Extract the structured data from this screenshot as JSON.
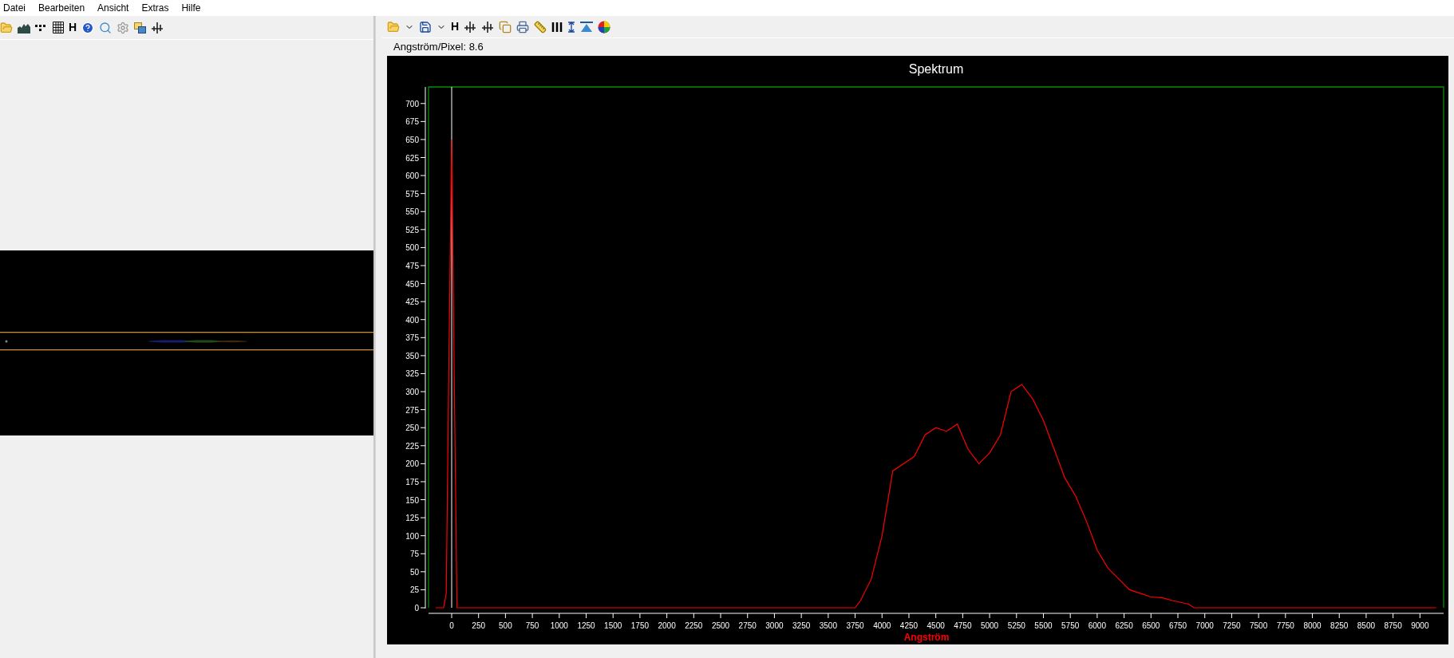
{
  "menu": [
    "Datei",
    "Bearbeiten",
    "Ansicht",
    "Extras",
    "Hilfe"
  ],
  "left_toolbar": {
    "h_label": "H"
  },
  "right_toolbar": {
    "h_label": "H"
  },
  "scale_label": "Angström/Pixel: 8.6",
  "spectrum_chart": {
    "chart_data": {
      "type": "line",
      "title": "Spektrum",
      "xlabel": "Angström",
      "x": [
        -150,
        -75,
        -50,
        -25,
        0,
        25,
        50,
        75,
        3750,
        3800,
        3900,
        4000,
        4100,
        4200,
        4300,
        4400,
        4500,
        4600,
        4700,
        4800,
        4900,
        5000,
        5100,
        5200,
        5300,
        5400,
        5500,
        5600,
        5700,
        5800,
        5900,
        6000,
        6100,
        6200,
        6300,
        6400,
        6500,
        6600,
        6700,
        6850,
        6900,
        9150
      ],
      "series": [
        {
          "color": "#ff0000",
          "values": [
            0,
            0,
            20,
            350,
            650,
            300,
            0,
            0,
            0,
            10,
            40,
            100,
            190,
            200,
            210,
            240,
            250,
            245,
            255,
            220,
            200,
            215,
            240,
            300,
            310,
            290,
            260,
            220,
            180,
            155,
            120,
            80,
            55,
            40,
            25,
            20,
            15,
            14,
            10,
            5,
            0,
            0
          ]
        }
      ],
      "xlim": [
        -215,
        9220
      ],
      "ylim": [
        0,
        723
      ],
      "xticks": [
        0,
        250,
        500,
        750,
        1000,
        1250,
        1500,
        1750,
        2000,
        2250,
        2500,
        2750,
        3000,
        3250,
        3500,
        3750,
        4000,
        4250,
        4500,
        4750,
        5000,
        5250,
        5500,
        5750,
        6000,
        6250,
        6500,
        6750,
        7000,
        7250,
        7500,
        7750,
        8000,
        8250,
        8500,
        8750,
        9000
      ],
      "yticks": [
        0,
        25,
        50,
        75,
        100,
        125,
        150,
        175,
        200,
        225,
        250,
        275,
        300,
        325,
        350,
        375,
        400,
        425,
        450,
        475,
        500,
        525,
        550,
        575,
        600,
        625,
        650,
        675,
        700
      ]
    }
  }
}
